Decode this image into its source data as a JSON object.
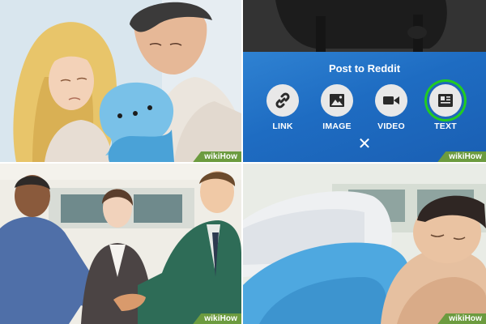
{
  "watermark": "wikiHow",
  "reddit_sheet": {
    "title": "Post to Reddit",
    "options": [
      {
        "label": "LINK",
        "icon": "link-icon"
      },
      {
        "label": "IMAGE",
        "icon": "image-icon"
      },
      {
        "label": "VIDEO",
        "icon": "video-camera-icon"
      },
      {
        "label": "TEXT",
        "icon": "text-post-icon",
        "selected": true
      }
    ],
    "close_glyph": "✕"
  },
  "colors": {
    "sheet_blue": "#1e6cc2",
    "highlight_green": "#22cc22",
    "watermark_green": "#6c9b3f"
  }
}
